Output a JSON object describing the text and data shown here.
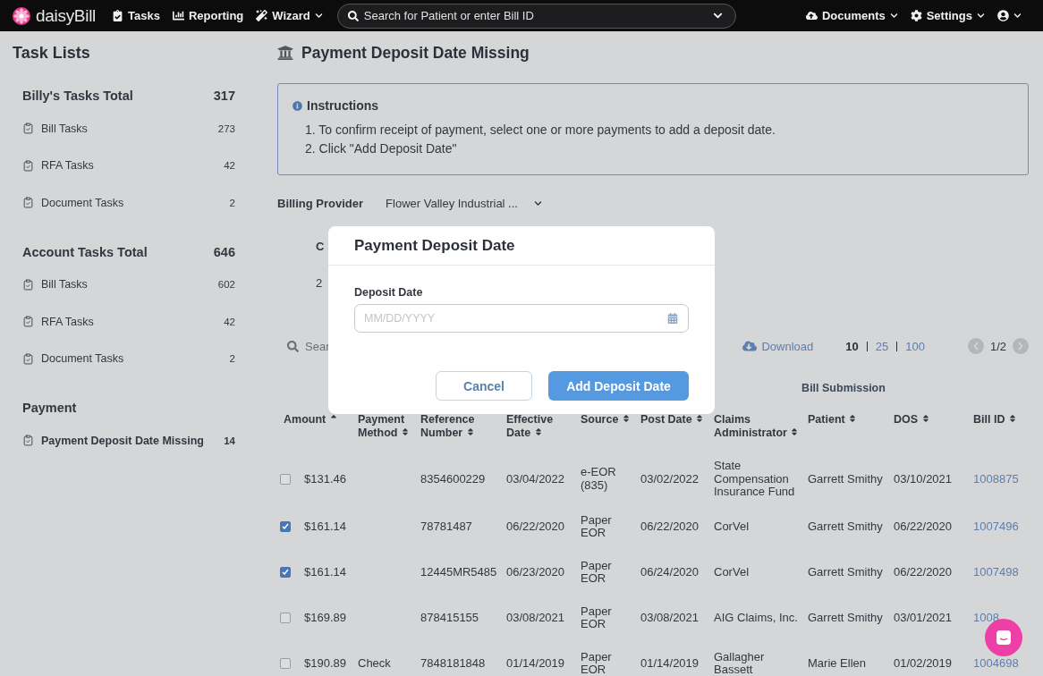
{
  "nav": {
    "brand": "daisyBill",
    "items": [
      {
        "label": "Tasks",
        "caret": false
      },
      {
        "label": "Reporting",
        "caret": false
      },
      {
        "label": "Wizard",
        "caret": true
      }
    ],
    "search": {
      "placeholder": "Search for Patient or enter Bill ID"
    },
    "right": [
      {
        "label": "Documents"
      },
      {
        "label": "Settings"
      }
    ]
  },
  "sidebar": {
    "title": "Task Lists",
    "sections": [
      {
        "title": "Billy's Tasks Total",
        "total": "317",
        "items": [
          {
            "label": "Bill Tasks",
            "count": "273",
            "selected": false
          },
          {
            "label": "RFA Tasks",
            "count": "42",
            "selected": false
          },
          {
            "label": "Document Tasks",
            "count": "2",
            "selected": false
          }
        ]
      },
      {
        "title": "Account Tasks Total",
        "total": "646",
        "items": [
          {
            "label": "Bill Tasks",
            "count": "602",
            "selected": false
          },
          {
            "label": "RFA Tasks",
            "count": "42",
            "selected": false
          },
          {
            "label": "Document Tasks",
            "count": "2",
            "selected": false
          }
        ]
      },
      {
        "title": "Payment",
        "items": [
          {
            "label": "Payment Deposit Date Missing",
            "count": "14",
            "selected": true
          }
        ]
      }
    ]
  },
  "page": {
    "title": "Payment Deposit Date Missing",
    "instructions": {
      "title": "Instructions",
      "steps": [
        "1. To confirm receipt of payment, select one or more payments to add a deposit date.",
        "2. Click \"Add Deposit Date\""
      ]
    },
    "billing_provider": {
      "label": "Billing Provider",
      "value": "Flower Valley Industrial ..."
    },
    "summary": {
      "column_1": "C",
      "value": "2"
    },
    "search": {
      "placeholder": "Sear"
    },
    "download": "Download",
    "page_sizes": [
      {
        "label": "10",
        "selected": true
      },
      {
        "label": "25",
        "selected": false
      },
      {
        "label": "100",
        "selected": false
      }
    ],
    "page_indicator": "1/2"
  },
  "table": {
    "group_header": "Bill Submission",
    "columns": [
      {
        "label": "Amount",
        "sorted": true
      },
      {
        "label": "Payment Method",
        "sorted": false
      },
      {
        "label": "Reference Number",
        "sorted": false
      },
      {
        "label": "Effective Date",
        "sorted": false
      },
      {
        "label": "Source",
        "sorted": false
      },
      {
        "label": "Post Date",
        "sorted": false
      },
      {
        "label": "Claims Administrator",
        "sorted": false
      },
      {
        "label": "Patient",
        "sorted": false
      },
      {
        "label": "DOS",
        "sorted": false
      },
      {
        "label": "Bill ID",
        "sorted": false
      }
    ],
    "rows": [
      {
        "checked": false,
        "cells": [
          "$131.46",
          "",
          "8354600229",
          "03/04/2022",
          "e-EOR (835)",
          "03/02/2022",
          "State Compensation Insurance Fund",
          "Garrett Smithy",
          "03/10/2021",
          "1008875"
        ]
      },
      {
        "checked": true,
        "cells": [
          "$161.14",
          "",
          "78781487",
          "06/22/2020",
          "Paper EOR",
          "06/22/2020",
          "CorVel",
          "Garrett Smithy",
          "06/22/2020",
          "1007496"
        ]
      },
      {
        "checked": true,
        "cells": [
          "$161.14",
          "",
          "12445MR5485",
          "06/23/2020",
          "Paper EOR",
          "06/24/2020",
          "CorVel",
          "Garrett Smithy",
          "06/22/2020",
          "1007498"
        ]
      },
      {
        "checked": false,
        "cells": [
          "$169.89",
          "",
          "878415155",
          "03/08/2021",
          "Paper EOR",
          "03/08/2021",
          "AIG Claims, Inc.",
          "Garrett Smithy",
          "03/01/2021",
          "1008"
        ]
      },
      {
        "checked": false,
        "cells": [
          "$190.89",
          "Check",
          "7848181848",
          "01/14/2019",
          "Paper EOR",
          "01/14/2019",
          "Gallagher Bassett",
          "Marie Ellen",
          "01/02/2019",
          "1004698"
        ]
      }
    ]
  },
  "modal": {
    "title": "Payment Deposit Date",
    "field_label": "Deposit Date",
    "placeholder": "MM/DD/YYYY",
    "buttons": [
      {
        "label": "Cancel",
        "kind": "secondary"
      },
      {
        "label": "Add Deposit Date",
        "kind": "primary"
      }
    ]
  }
}
